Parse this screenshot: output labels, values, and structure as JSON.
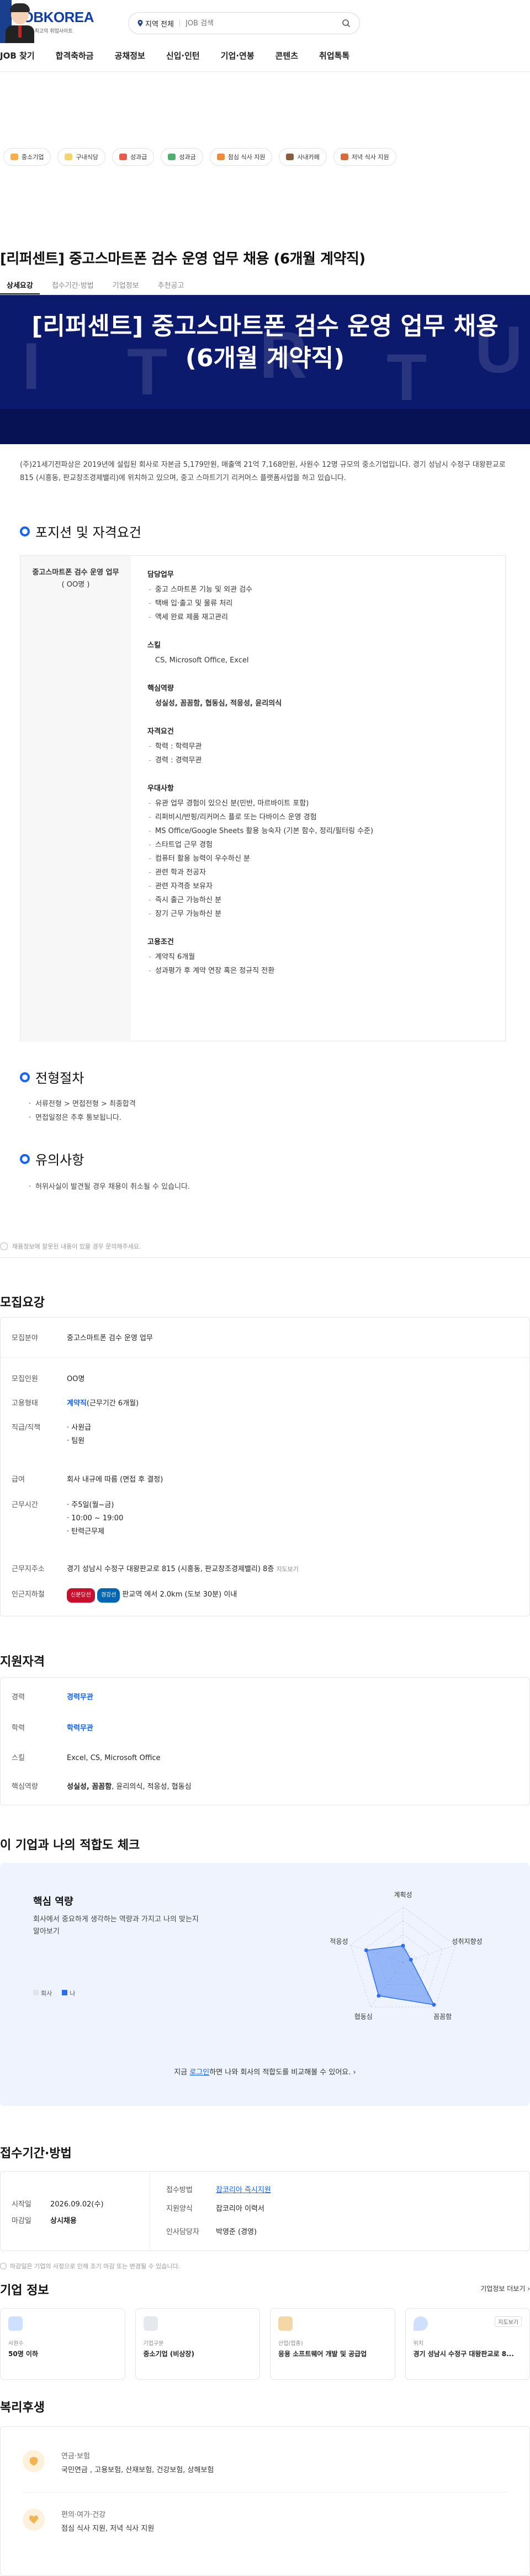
{
  "header": {
    "brand": "JOBKOREA",
    "tagline": "대한민국 최고의 취업사이트",
    "location": "지역 전체",
    "search_placeholder": "JOB 검색",
    "nav": [
      "JOB 찾기",
      "합격축하금",
      "공채정보",
      "신입·인턴",
      "기업·연봉",
      "콘텐츠",
      "취업톡톡"
    ]
  },
  "chips": [
    {
      "label": "중소기업",
      "color": "#f5b04a"
    },
    {
      "label": "구내식당",
      "color": "#f7d36b"
    },
    {
      "label": "성과급",
      "color": "#e85a4f"
    },
    {
      "label": "성과금",
      "color": "#4fb06e"
    },
    {
      "label": "점심 식사 지원",
      "color": "#f08a3c"
    },
    {
      "label": "사내카페",
      "color": "#8a5a3c"
    },
    {
      "label": "저녁 식사 지원",
      "color": "#d66b3c"
    }
  ],
  "job": {
    "title": "[리퍼센트] 중고스마트폰 검수 운영 업무 채용 (6개월 계약직)",
    "tabs": [
      "상세요강",
      "접수기간·방법",
      "기업정보",
      "추천공고"
    ],
    "banner_line1": "[리퍼센트] 중고스마트폰 검수 운영 업무 채용",
    "banner_line2": "(6개월 계약직)",
    "intro": "(주)21세기전파상은 2019년에 설립된 회사로 자본금 5,179만원, 매출액 21억 7,168만원, 사원수 12명 규모의 중소기업입니다. 경기 성남시 수정구 대왕판교로 815 (시흥동, 판교창조경제밸리)에 위치하고 있으며, 중고 스마트기기 리커머스 플랫폼사업을 하고 있습니다."
  },
  "position": {
    "section_title": "포지션 및 자격요건",
    "left_title": "중고스마트폰 검수 운영 업무",
    "left_count": "( OO명 )",
    "groups": [
      {
        "title": "담당업무",
        "items": [
          "중고 스마트폰 기능 및 외관 검수",
          "택배 입·출고 및 물류 처리",
          "액세 완료 제품 재고관리"
        ]
      },
      {
        "title": "스킬",
        "items": [
          "CS, Microsoft Office, Excel"
        ]
      },
      {
        "title": "핵심역량",
        "items": [
          "성실성, 꼼꼼함, 협동심, 적응성, 윤리의식"
        ]
      },
      {
        "title": "자격요건",
        "items": [
          "학력 : 학력무관",
          "경력 : 경력무관"
        ]
      },
      {
        "title": "우대사항",
        "items": [
          "유관 업무 경험이 있으신 분(민반, 마르바이트 포함)",
          "리퍼비시/반핑/리커머스 플로 또는 다바이스 운영 경험",
          "MS Office/Google Sheets 활용 능숙자 (기본 함수, 정리/필터링 수준)",
          "스타트업 근무 경험",
          "컴퓨터 활용 능력이 우수하신 분",
          "관련 학과 전공자",
          "관련 자격증 보유자",
          "즉시 출근 가능하신 분",
          "장기 근무 가능하신 분"
        ]
      },
      {
        "title": "고용조건",
        "items": [
          "계약직 6개월",
          "성과평가 후 계약 연장 혹은 정규직 전환"
        ]
      }
    ]
  },
  "process": {
    "title": "전형절차",
    "items": [
      "서류전형 > 면접전형 > 최종합격",
      "면접일정은 추후 통보됩니다."
    ]
  },
  "caution": {
    "title": "유의사항",
    "items": [
      "허위사실이 발견될 경우 채용이 취소될 수 있습니다."
    ]
  },
  "notice": "채용정보에 잘못된 내용이 있을 경우 문의해주세요.",
  "summary": {
    "title": "모집요강",
    "field_label": "모집분야",
    "field_value": "중고스마트폰 검수 운영 업무",
    "count_label": "모집인원",
    "count_value": "OO명",
    "employ_label": "고용형태",
    "employ_value": "계약직",
    "employ_extra": "(근무기간 6개월)",
    "rank_label": "직급/직책",
    "rank_items": [
      "사원급",
      "팀원"
    ],
    "salary_label": "급여",
    "salary_value": "회사 내규에 따름 (면접 후 결정)",
    "hours_label": "근무시간",
    "hours_items": [
      "주5일(월~금)",
      "10:00 ~ 19:00",
      "탄력근무제"
    ],
    "addr_label": "근무지주소",
    "addr_value": "경기 성남시 수정구 대왕판교로 815 (시흥동, 판교창조경제밸리) 8층",
    "addr_link": "지도보기",
    "subway_label": "인근지하철",
    "subway_badge1": "신분당선",
    "subway_badge2": "경강선",
    "subway_value": "판교역 에서 2.0km (도보 30분) 이내"
  },
  "qual": {
    "title": "지원자격",
    "rows": [
      {
        "k": "경력",
        "v": "경력무관"
      },
      {
        "k": "학력",
        "v": "학력무관"
      },
      {
        "k": "스킬",
        "v": "Excel, CS, Microsoft Office"
      },
      {
        "k": "핵심역량",
        "v": "성실성, 꼼꼼함",
        "v2": ", 윤리의식, 적응성, 협동심"
      }
    ]
  },
  "fit": {
    "title": "이 기업과 나의 적합도 체크",
    "card_title": "핵심 역량",
    "card_desc": "회사에서 중요하게 생각하는 역량과 가지고 나의 맞는지 알아보기",
    "legend_company": "회사",
    "legend_me": "나",
    "axes": [
      "계획성",
      "성취지향성",
      "꼼꼼함",
      "협동심",
      "적응성"
    ],
    "values": [
      0.3,
      0.15,
      0.95,
      0.75,
      0.7
    ],
    "cta_pre": "지금",
    "cta_link": "로그인",
    "cta_post": "하면 나와 회사의 적합도를 비교해볼 수 있어요."
  },
  "apply": {
    "title": "접수기간·방법",
    "start_label": "시작일",
    "start_value": "2026.09.02(수)",
    "end_label": "마감일",
    "end_value": "상시채용",
    "method_label": "접수방법",
    "method_value": "잡코리아 즉시지원",
    "form_label": "지원양식",
    "form_value": "잡코리아 이력서",
    "manager_label": "인사담당자",
    "manager_value": "박영준 (경영)",
    "note": "마감일은 기업의 사정으로 인해 조기 마감 또는 변경될 수 있습니다."
  },
  "company": {
    "title": "기업 정보",
    "more": "기업정보 더보기",
    "cards": [
      {
        "label": "사원수",
        "value": "50명 이하",
        "color": "#cfe0ff"
      },
      {
        "label": "기업구분",
        "value": "중소기업 (비상장)",
        "color": "#e5e8ee"
      },
      {
        "label": "산업(업종)",
        "value": "응용 소프트웨어 개발 및 공급업",
        "color": "#f5d6a7"
      },
      {
        "label": "위치",
        "value": "경기 성남시 수정구 대왕판교로 8...",
        "color": "#cfe0ff"
      }
    ],
    "map_label": "지도보기"
  },
  "welfare": {
    "title": "복리후생",
    "rows": [
      {
        "title": "연금·보험",
        "desc": "국민연금 , 고용보험, 산재보험, 건강보험, 상해보험"
      },
      {
        "title": "편의·여가·건강",
        "desc": "점심 식사 지원, 저녁 식사 지원"
      }
    ]
  }
}
